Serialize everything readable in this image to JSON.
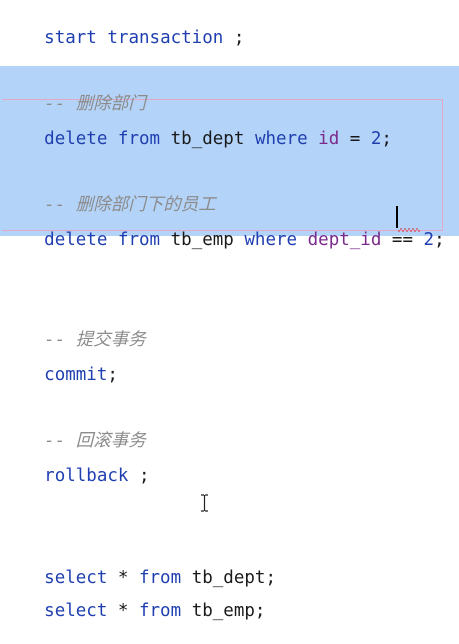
{
  "lines": {
    "l1": {
      "kw1": "start",
      "kw2": "transaction",
      "end": " ;"
    },
    "c1": {
      "dash": "-- ",
      "text": "删除部门"
    },
    "l2": {
      "kw1": "delete",
      "kw2": "from",
      "table": "tb_dept",
      "kw3": "where",
      "field": "id",
      "op": " = ",
      "num": "2",
      "end": ";"
    },
    "c2": {
      "dash": "-- ",
      "text": "删除部门下的员工"
    },
    "l3": {
      "kw1": "delete",
      "kw2": "from",
      "table": "tb_emp",
      "kw3": "where",
      "field": "dept_id",
      "op": " == ",
      "num": "2",
      "end": ";"
    },
    "c3": {
      "dash": "-- ",
      "text": "提交事务"
    },
    "l4": {
      "kw": "commit",
      "end": ";"
    },
    "c4": {
      "dash": "-- ",
      "text": "回滚事务"
    },
    "l5": {
      "kw": "rollback",
      "end": " ;"
    },
    "l6": {
      "kw1": "select",
      "star": " * ",
      "kw2": "from",
      "table": "tb_dept",
      "end": ";"
    },
    "l7": {
      "kw1": "select",
      "star": " * ",
      "kw2": "from",
      "table": "tb_emp",
      "end": ";"
    }
  },
  "colors": {
    "keyword": "#1f3fb0",
    "field": "#7a2a8a",
    "comment": "#8c8c8c",
    "selection": "#b3d3f8",
    "error_underline": "#d92b2b"
  },
  "icons": {
    "cursor": "text-cursor-icon"
  }
}
